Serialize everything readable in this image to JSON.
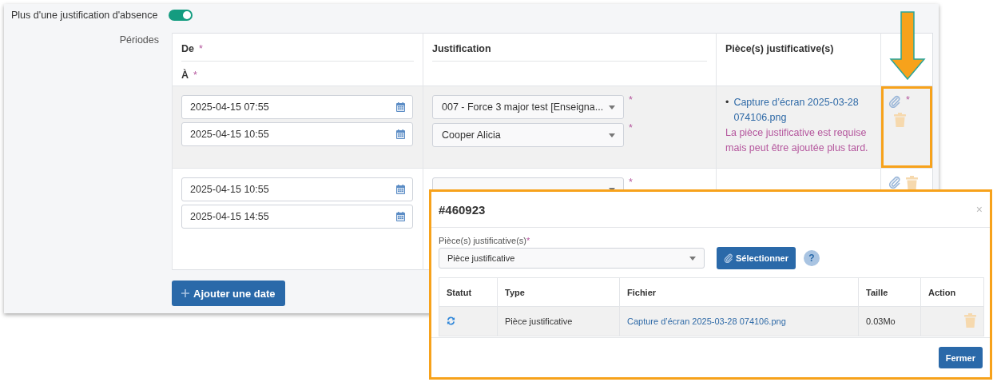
{
  "toggle": {
    "label": "Plus d'une justification d'absence",
    "on": true
  },
  "periods": {
    "label": "Périodes",
    "header": {
      "from": {
        "label": "De",
        "mark": "*"
      },
      "to": {
        "label": "À",
        "mark": "*"
      },
      "justification": "Justification",
      "attachments": "Pièce(s) justificative(s)"
    },
    "rows": [
      {
        "highlighted": true,
        "callout": true,
        "from": "2025-04-15 07:55",
        "to": "2025-04-15 10:55",
        "justification": {
          "value": "007 - Force 3 major test [Enseigna...",
          "mark": "*"
        },
        "person": {
          "value": "Cooper Alicia",
          "mark": "*"
        },
        "files": [
          {
            "bullet": "•",
            "name": "Capture d’écran 2025-03-28 074106.png"
          }
        ],
        "note": "La pièce justificative est requise mais peut être ajoutée plus tard.",
        "attach_mark": "*"
      },
      {
        "highlighted": false,
        "callout": false,
        "from": "2025-04-15 10:55",
        "to": "2025-04-15 14:55",
        "justification": {
          "mark": "*"
        }
      }
    ],
    "add_button": "Ajouter une date"
  },
  "modal": {
    "title": "#460923",
    "close": "×",
    "field": {
      "label": "Pièce(s) justificative(s)",
      "mark": "*",
      "value": "Pièce justificative"
    },
    "select_button": "Sélectionner",
    "help": "?",
    "table": {
      "columns": [
        "Statut",
        "Type",
        "Fichier",
        "Taille",
        "Action"
      ],
      "rows": [
        {
          "type": "Pièce justificative",
          "file": "Capture d’écran 2025-03-28 074106.png",
          "size": "0.03Mo"
        }
      ]
    },
    "close_button": "Fermer"
  }
}
